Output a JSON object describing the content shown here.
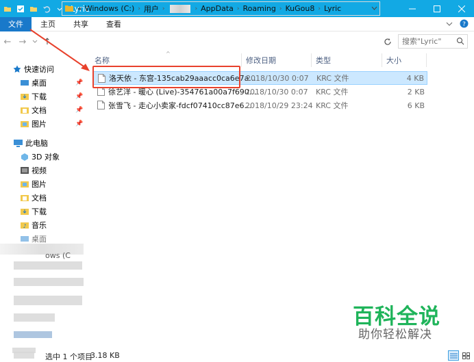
{
  "window": {
    "title": "Lyric"
  },
  "ribbon": {
    "tabs": [
      "文件",
      "主页",
      "共享",
      "查看"
    ]
  },
  "address": {
    "segments": [
      "Windows (C:)",
      "用户",
      "AppData",
      "Roaming",
      "KuGou8",
      "Lyric"
    ],
    "prefix": "«"
  },
  "search": {
    "placeholder": "搜索\"Lyric\""
  },
  "nav": {
    "quick_access": "快速访问",
    "quick_items": [
      "桌面",
      "下载",
      "文档",
      "图片"
    ],
    "this_pc": "此电脑",
    "pc_items": [
      "3D 对象",
      "视频",
      "图片",
      "文档",
      "下载",
      "音乐",
      "桌面"
    ],
    "partial_text": "ows (C"
  },
  "columns": {
    "name": "名称",
    "date": "修改日期",
    "type": "类型",
    "size": "大小"
  },
  "files": [
    {
      "name": "洛天依 - 东宫-135cab29aaacc0ca6e7a...",
      "date": "2018/10/30 0:07",
      "type": "KRC 文件",
      "size": "4 KB"
    },
    {
      "name": "徐艺洋 - 暖心 (Live)-354761a00a7f690...",
      "date": "2018/10/30 0:07",
      "type": "KRC 文件",
      "size": "2 KB"
    },
    {
      "name": "张雪飞 - 走心小卖家-fdcf07410cc87e6...",
      "date": "2018/10/29 23:24",
      "type": "KRC 文件",
      "size": "6 KB"
    }
  ],
  "status": {
    "items": "选中 1 个项目",
    "size": "3.18 KB"
  },
  "watermark": {
    "title": "百科全说",
    "subtitle": "助你轻松解决"
  },
  "colors": {
    "titlebar": "#12a9e4",
    "file_tab": "#1979ca",
    "selection": "#cce8ff",
    "annotation": "#e8412c",
    "watermark": "#1fb45a"
  }
}
